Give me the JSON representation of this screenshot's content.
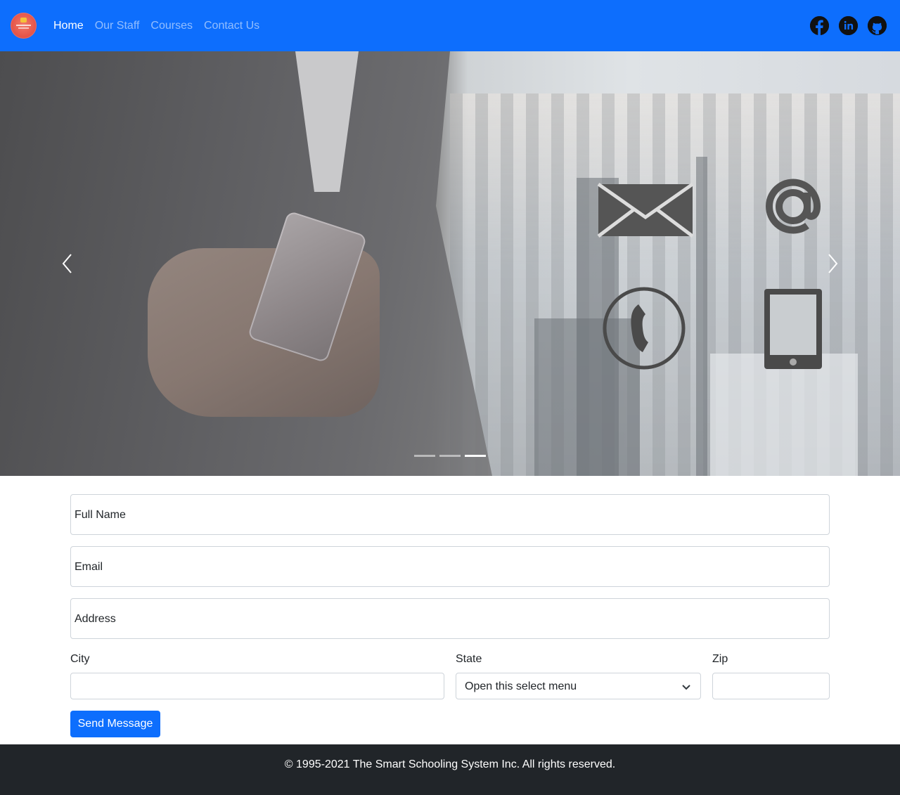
{
  "navbar": {
    "brand_color": "#0d6efd",
    "logo_icon": "school-logo",
    "links": [
      {
        "label": "Home",
        "active": true
      },
      {
        "label": "Our Staff",
        "active": false
      },
      {
        "label": "Courses",
        "active": false
      },
      {
        "label": "Contact Us",
        "active": false
      }
    ],
    "social": [
      {
        "icon": "facebook-icon"
      },
      {
        "icon": "linkedin-icon"
      },
      {
        "icon": "github-icon"
      }
    ]
  },
  "hero": {
    "slide_count": 3,
    "active_slide": 3,
    "contact_icons": [
      "envelope-icon",
      "at-sign-icon",
      "phone-icon",
      "tablet-icon"
    ],
    "prev_icon": "chevron-left-icon",
    "next_icon": "chevron-right-icon"
  },
  "form": {
    "full_name_placeholder": "Full Name",
    "email_placeholder": "Email",
    "address_placeholder": "Address",
    "city_label": "City",
    "state_label": "State",
    "state_selected": "Open this select menu",
    "zip_label": "Zip",
    "submit_label": "Send Message"
  },
  "footer": {
    "copyright": "© 1995-2021 The Smart Schooling System Inc. All rights reserved."
  }
}
